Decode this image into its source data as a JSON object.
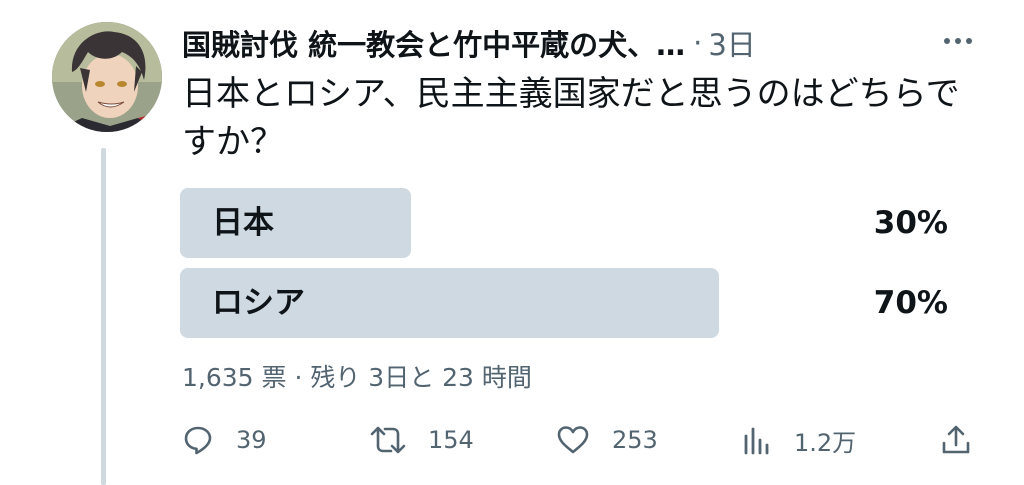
{
  "tweet": {
    "author_name": "国賊討伐 統一教会と竹中平蔵の犬、…",
    "separator": "·",
    "time": "3日",
    "text": "日本とロシア、民主主義国家だと思うのはどちらですか？"
  },
  "poll": {
    "options": [
      {
        "label": "日本",
        "percent_text": "30%",
        "fraction": 0.3
      },
      {
        "label": "ロシア",
        "percent_text": "70%",
        "fraction": 0.7
      }
    ],
    "summary": "1,635 票 · 残り 3日と 23 時間"
  },
  "actions": {
    "reply_count": "39",
    "retweet_count": "154",
    "like_count": "253",
    "views_count": "1.2万"
  },
  "colors": {
    "poll_bar": "#cfd9e1",
    "secondary_text": "#536471",
    "thread_line": "#cfd9de"
  }
}
